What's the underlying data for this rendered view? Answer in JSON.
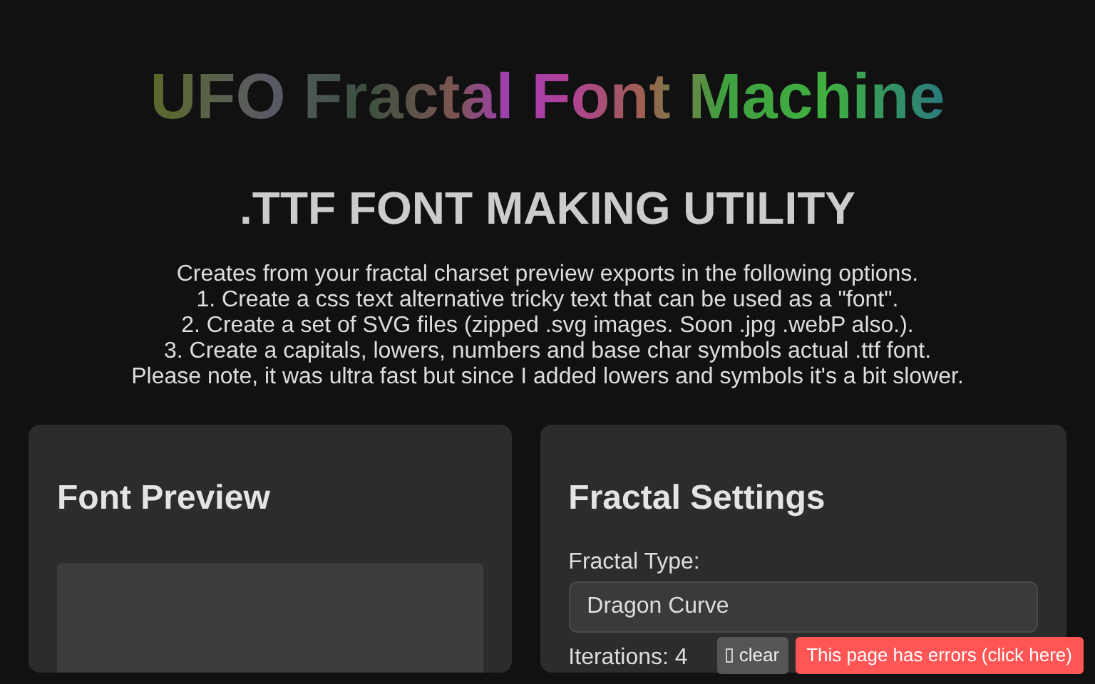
{
  "title": "UFO Fractal Font Machine",
  "subtitle": ".TTF FONT MAKING UTILITY",
  "description": [
    "Creates from your fractal charset preview exports in the following options.",
    "1. Create a css text alternative tricky text that can be used as a \"font\".",
    "2. Create a set of SVG files (zipped .svg images. Soon .jpg .webP also.).",
    "3. Create a capitals, lowers, numbers and base char symbols actual .ttf font.",
    "Please note, it was ultra fast but since I added lowers and symbols it's a bit slower."
  ],
  "preview_panel": {
    "title": "Font Preview"
  },
  "settings_panel": {
    "title": "Fractal Settings",
    "fractal_type_label": "Fractal Type:",
    "fractal_type_value": "Dragon Curve",
    "iterations_label": "Iterations: 4"
  },
  "error_bar": {
    "clear_label": "clear",
    "error_label": "This page has errors (click here)"
  }
}
